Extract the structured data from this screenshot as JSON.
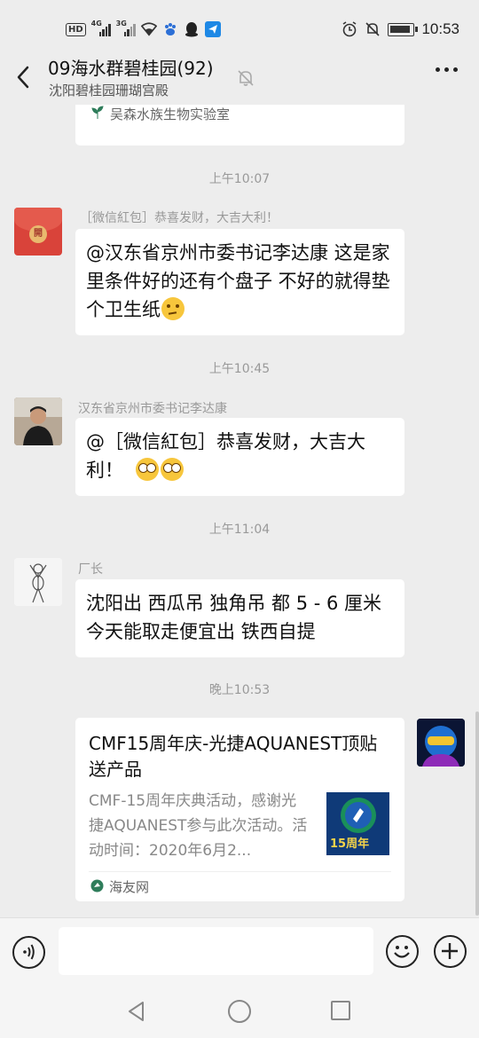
{
  "status_bar": {
    "hd": "HD",
    "sim1_net": "4G",
    "sim2_net": "3G",
    "time": "10:53"
  },
  "header": {
    "title": "09海水群碧桂园(92)",
    "subtitle": "沈阳碧桂园珊瑚宫殿"
  },
  "messages": {
    "top_card_source": "吴森水族生物实验室",
    "ts1": "上午10:07",
    "msg1_header": "［微信紅包］恭喜发财，大吉大利！",
    "msg1_text": "@汉东省京州市委书记李达康  这是家里条件好的还有个盘子 不好的就得垫个卫生纸",
    "redpacket_char": "開",
    "ts2": "上午10:45",
    "msg2_sender": "汉东省京州市委书记李达康",
    "msg2_text": "@［微信紅包］恭喜发财，大吉大利！",
    "ts3": "上午11:04",
    "msg3_sender": "厂长",
    "msg3_line1": "沈阳出 西瓜吊 独角吊 都 5 - 6 厘米",
    "msg3_line2": "今天能取走便宜出 铁西自提",
    "ts4": "晚上10:53",
    "card_title": "CMF15周年庆-光捷AQUANEST顶贴送产品",
    "card_desc": "CMF-15周年庆典活动，感谢光捷AQUANEST参与此次活动。活动时间：2020年6月2...",
    "card_thumb_text": "15周年",
    "card_source": "海友网"
  },
  "colors": {
    "background": "#ededed",
    "bubble": "#ffffff",
    "redpacket": "#d9433a",
    "timestamp": "#999999"
  }
}
